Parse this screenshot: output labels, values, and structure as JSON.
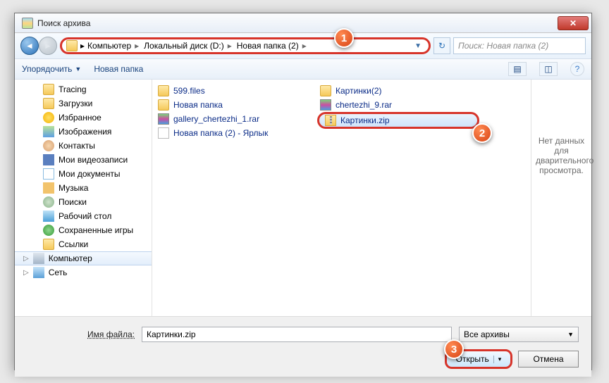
{
  "window": {
    "title": "Поиск архива"
  },
  "breadcrumbs": {
    "b0": "Компьютер",
    "b1": "Локальный диск (D:)",
    "b2": "Новая папка (2)"
  },
  "search": {
    "placeholder": "Поиск: Новая папка (2)"
  },
  "toolbar": {
    "organize": "Упорядочить",
    "newfolder": "Новая папка"
  },
  "sidebar": {
    "tracing": "Tracing",
    "downloads": "Загрузки",
    "favorites": "Избранное",
    "images": "Изображения",
    "contacts": "Контакты",
    "myvideos": "Мои видеозаписи",
    "mydocs": "Мои документы",
    "music": "Музыка",
    "searches": "Поиски",
    "desktop": "Рабочий стол",
    "savedgames": "Сохраненные игры",
    "links": "Ссылки",
    "computer": "Компьютер",
    "network": "Сеть"
  },
  "files": {
    "c0r0": "599.files",
    "c0r1": "Новая папка",
    "c0r2": "gallery_chertezhi_1.rar",
    "c0r3": "Новая папка (2) - Ярлык",
    "c1r0": "Картинки(2)",
    "c1r1": "chertezhi_9.rar",
    "c1r2": "Картинки.zip"
  },
  "preview": {
    "line1": "Нет данных",
    "line2": "для",
    "line3": "дварительного",
    "line4": "просмотра."
  },
  "bottom": {
    "filename_label": "Имя файла:",
    "filename_value": "Картинки.zip",
    "filter": "Все архивы",
    "open": "Открыть",
    "cancel": "Отмена"
  },
  "callouts": {
    "c1": "1",
    "c2": "2",
    "c3": "3"
  }
}
